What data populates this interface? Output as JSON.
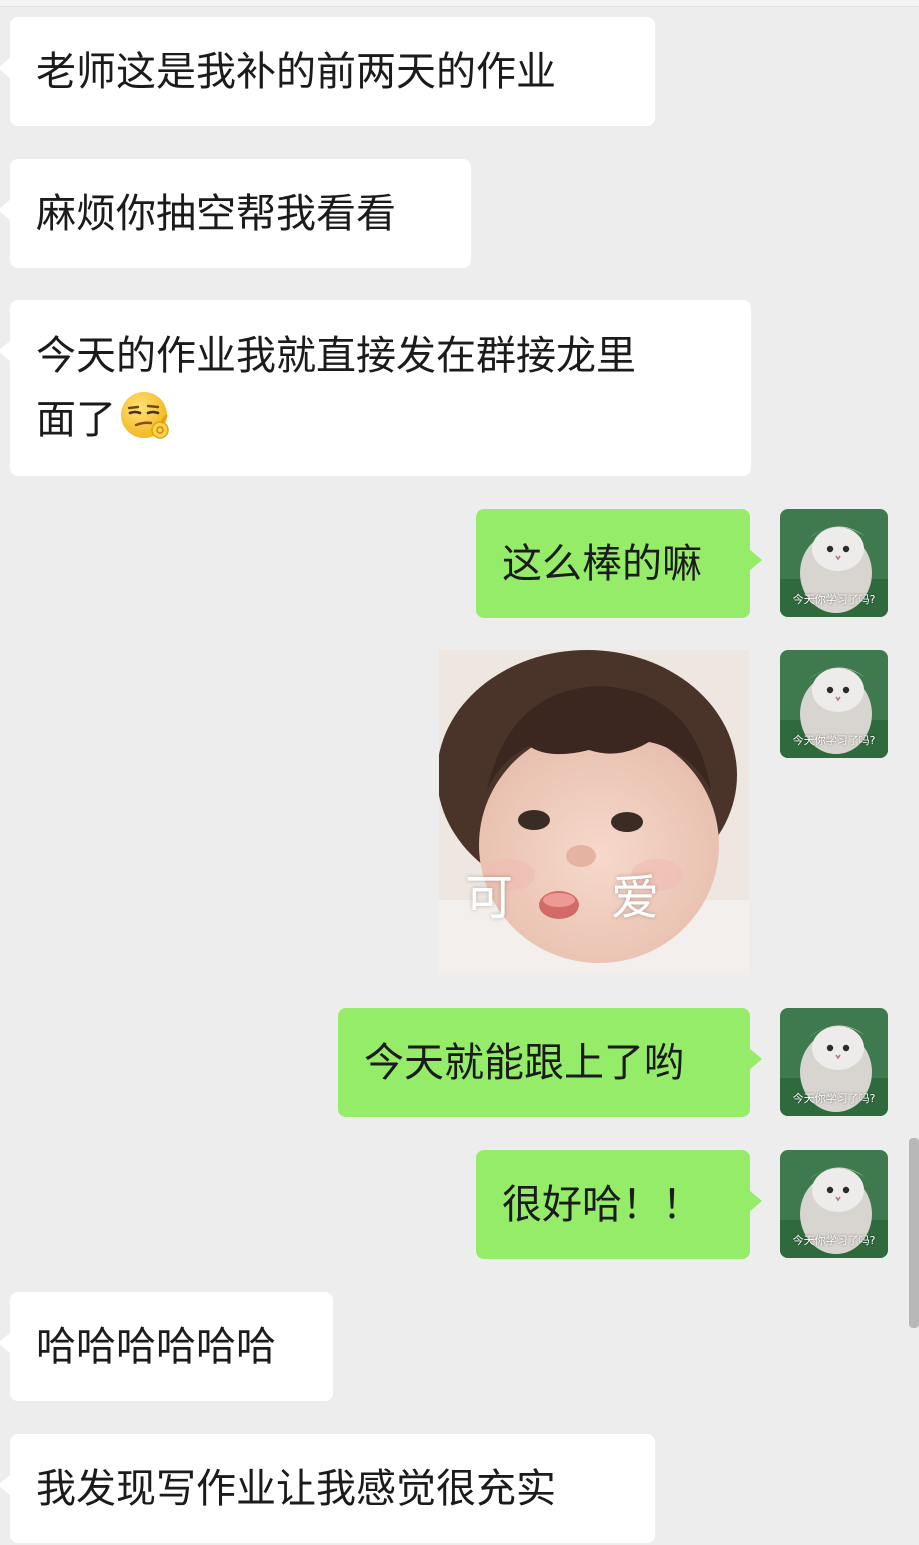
{
  "messages": [
    {
      "side": "in",
      "text": "老师这是我补的前两天的作业"
    },
    {
      "side": "in",
      "text": "麻烦你抽空帮我看看"
    },
    {
      "side": "in",
      "lines": [
        "今天的作业我就直接发在群接龙里",
        "面了"
      ],
      "emoji": "smirk-ok-emoji"
    },
    {
      "side": "out",
      "text": "这么棒的嘛"
    },
    {
      "side": "out",
      "type": "sticker",
      "caption_left": "可",
      "caption_right": "爱"
    },
    {
      "side": "out",
      "text": "今天就能跟上了哟"
    },
    {
      "side": "out",
      "text": "很好哈！！"
    },
    {
      "side": "in",
      "text": "哈哈哈哈哈哈"
    },
    {
      "side": "in",
      "text": "我发现写作业让我感觉很充实"
    }
  ],
  "self_avatar": {
    "caption": "今天你学习了吗?",
    "icon": "cat-avatar-icon"
  },
  "colors": {
    "background": "#ededed",
    "incoming_bubble": "#ffffff",
    "outgoing_bubble": "#95ec69",
    "text": "#1b1b1b"
  }
}
